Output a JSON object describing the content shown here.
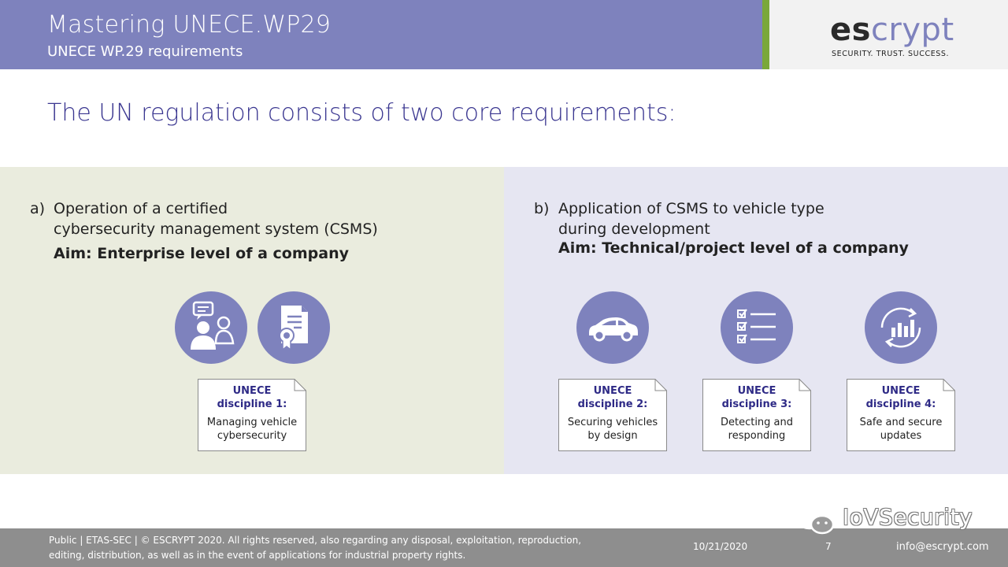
{
  "header": {
    "title": "Mastering UNECE.WP29",
    "subtitle": "UNECE WP.29 requirements"
  },
  "logo": {
    "part1": "es",
    "part2": "crypt",
    "tagline": "SECURITY. TRUST. SUCCESS."
  },
  "heading": "The UN regulation consists of two core requirements:",
  "req_a": {
    "marker": "a)",
    "line1": "Operation of a certified",
    "line2": "cybersecurity management system (CSMS)",
    "aim": "Aim: Enterprise level of a company"
  },
  "req_b": {
    "marker": "b)",
    "line1": "Application of CSMS to vehicle type",
    "line2": "during development",
    "aim": "Aim: Technical/project level of a company"
  },
  "disciplines": [
    {
      "head1": "UNECE",
      "head2": "discipline 1:",
      "body1": "Managing vehicle",
      "body2": "cybersecurity"
    },
    {
      "head1": "UNECE",
      "head2": "discipline 2:",
      "body1": "Securing vehicles",
      "body2": "by design"
    },
    {
      "head1": "UNECE",
      "head2": "discipline 3:",
      "body1": "Detecting and",
      "body2": "responding"
    },
    {
      "head1": "UNECE",
      "head2": "discipline 4:",
      "body1": "Safe and secure",
      "body2": "updates"
    }
  ],
  "icons": {
    "a1": "people-conversation-icon",
    "a2": "certificate-document-icon",
    "b1": "car-icon",
    "b2": "checklist-icon",
    "b3": "update-cycle-chart-icon"
  },
  "footer": {
    "legal1": "Public | ETAS-SEC | © ESCRYPT 2020. All rights reserved, also regarding any disposal, exploitation, reproduction,",
    "legal2": "editing, distribution, as well as in the event of applications for industrial property rights.",
    "date": "10/21/2020",
    "page": "7",
    "email": "info@escrypt.com"
  },
  "watermark": "IoVSecurity",
  "colors": {
    "header": "#7e82bd",
    "accent_green": "#7aa83a",
    "heading": "#3a3690",
    "panel_a": "#eaecde",
    "panel_b": "#e6e6f2",
    "footer": "#8e8e8e"
  }
}
